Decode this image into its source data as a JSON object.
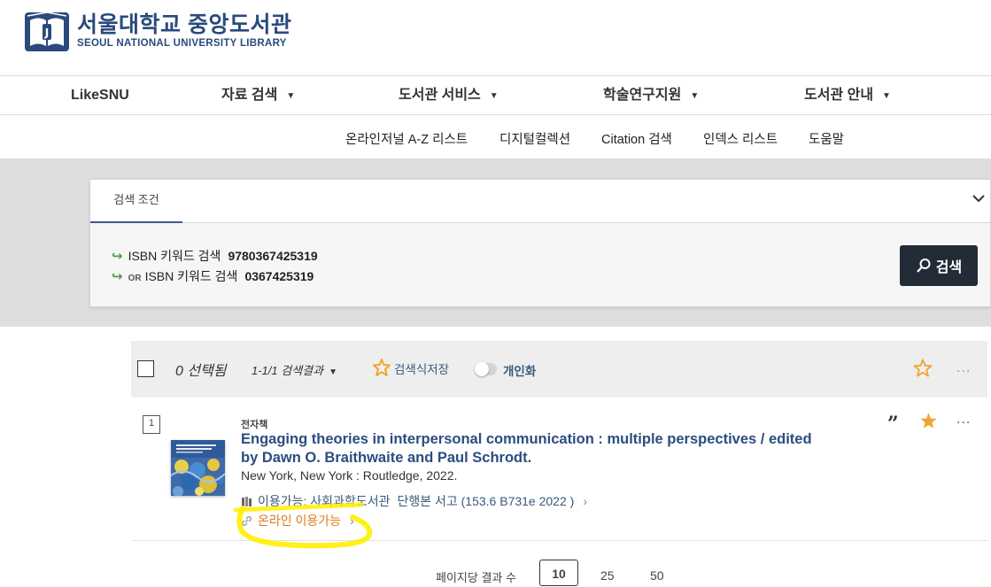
{
  "header": {
    "logo_korean": "서울대학교 중앙도서관",
    "logo_english": "SEOUL NATIONAL UNIVERSITY LIBRARY",
    "brand_color": "#2a4a7d"
  },
  "topnav": {
    "items": [
      {
        "label": "LikeSNU",
        "has_dropdown": false
      },
      {
        "label": "자료 검색",
        "has_dropdown": true
      },
      {
        "label": "도서관 서비스",
        "has_dropdown": true
      },
      {
        "label": "학술연구지원",
        "has_dropdown": true
      },
      {
        "label": "도서관 안내",
        "has_dropdown": true
      }
    ],
    "caret": "▼"
  },
  "subnav": {
    "items": [
      "온라인저널 A-Z 리스트",
      "디지털컬렉션",
      "Citation 검색",
      "인덱스 리스트",
      "도움말"
    ]
  },
  "search": {
    "tab_label": "검색 조건",
    "queries": [
      {
        "prefix": "",
        "field": "ISBN 키워드 검색",
        "value": "9780367425319"
      },
      {
        "prefix": "OR",
        "field": "ISBN 키워드 검색",
        "value": "0367425319"
      }
    ],
    "search_button_label": "검색"
  },
  "results_bar": {
    "selected": "0 선택됨",
    "range": "1-1/1 검색결과",
    "save_search": "검색식저장",
    "personalize": "개인화",
    "personalize_on": false,
    "more": "..."
  },
  "results": [
    {
      "number": "1",
      "type": "전자책",
      "title": "Engaging theories in interpersonal communication : multiple perspectives / edited by Dawn O. Braithwaite and Paul Schrodt.",
      "publication": "New York, New York : Routledge, 2022.",
      "availability_status": "이용가능: 사회과학도서관",
      "availability_location": "단행본 서고 (153.6 B731e 2022 )",
      "online": "온라인 이용가능",
      "favorited": true
    }
  ],
  "pager": {
    "label": "페이지당 결과 수",
    "options": [
      "10",
      "25",
      "50"
    ],
    "active": "10"
  },
  "colors": {
    "link": "#2b4d80",
    "online": "#e07b1f",
    "star": "#f0a532",
    "highlight": "#ffef00"
  }
}
